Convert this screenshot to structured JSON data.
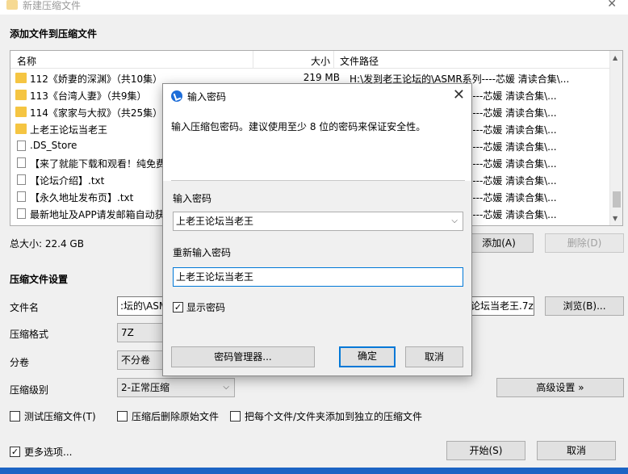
{
  "window": {
    "title": "新建压缩文件",
    "close_glyph": "✕"
  },
  "add_section": {
    "header": "添加文件到压缩文件"
  },
  "file_list": {
    "columns": {
      "name": "名称",
      "size": "大小",
      "path": "文件路径"
    },
    "rows": [
      {
        "icon": "folder-icon",
        "name": "112《娇妻的深渊》（共10集）",
        "size": "219 MB",
        "path": "H:\\发到老王论坛的\\ASMR系列----芯媛 清读合集\\..."
      },
      {
        "icon": "folder-icon",
        "name": "113《台湾人妻》（共9集）",
        "size": "",
        "path": "----芯媛 清读合集\\..."
      },
      {
        "icon": "folder-icon",
        "name": "114《家家与大叔》（共25集）",
        "size": "",
        "path": "----芯媛 清读合集\\..."
      },
      {
        "icon": "folder-icon",
        "name": "上老王论坛当老王",
        "size": "",
        "path": "----芯媛 清读合集\\..."
      },
      {
        "icon": "file-icon",
        "name": ".DS_Store",
        "size": "",
        "path": "----芯媛 清读合集\\..."
      },
      {
        "icon": "text-file-icon",
        "name": "【来了就能下载和观看！纯免费",
        "size": "",
        "path": "----芯媛 清读合集\\..."
      },
      {
        "icon": "text-file-icon",
        "name": "【论坛介绍】.txt",
        "size": "",
        "path": "----芯媛 清读合集\\..."
      },
      {
        "icon": "text-file-icon",
        "name": "【永久地址发布页】.txt",
        "size": "",
        "path": "----芯媛 清读合集\\..."
      },
      {
        "icon": "text-file-icon",
        "name": "最新地址及APP请发邮箱自动获",
        "size": "",
        "path": "----芯媛 清读合集\\..."
      }
    ]
  },
  "total_size": "总大小: 22.4 GB",
  "buttons": {
    "add": "添加(A)",
    "delete": "删除(D)",
    "browse": "浏览(B)...",
    "advanced": "高级设置 »",
    "start": "开始(S)",
    "cancel": "取消"
  },
  "settings": {
    "header": "压缩文件设置",
    "filename_label": "文件名",
    "filename_value": ":坛的\\ASM",
    "filename_tail": "论坛当老王.7z",
    "format_label": "压缩格式",
    "format_value": "7Z",
    "split_label": "分卷",
    "split_value": "不分卷",
    "level_label": "压缩级别",
    "level_value": "2-正常压缩",
    "opt_test": "测试压缩文件(T)",
    "opt_delete": "压缩后删除原始文件",
    "opt_each": "把每个文件/文件夹添加到独立的压缩文件",
    "more_options": "更多选项..."
  },
  "dialog": {
    "title": "输入密码",
    "info": "输入压缩包密码。建议使用至少 8 位的密码来保证安全性。",
    "password_label": "输入密码",
    "password_value": "上老王论坛当老王",
    "reenter_label": "重新输入密码",
    "reenter_value": "上老王论坛当老王",
    "show_password": "显示密码",
    "show_password_checked": true,
    "manager_button": "密码管理器...",
    "ok_button": "确定",
    "cancel_button": "取消"
  },
  "colors": {
    "accent": "#0078d7",
    "folder": "#f5c542",
    "taskbar": "#1c64c4"
  }
}
